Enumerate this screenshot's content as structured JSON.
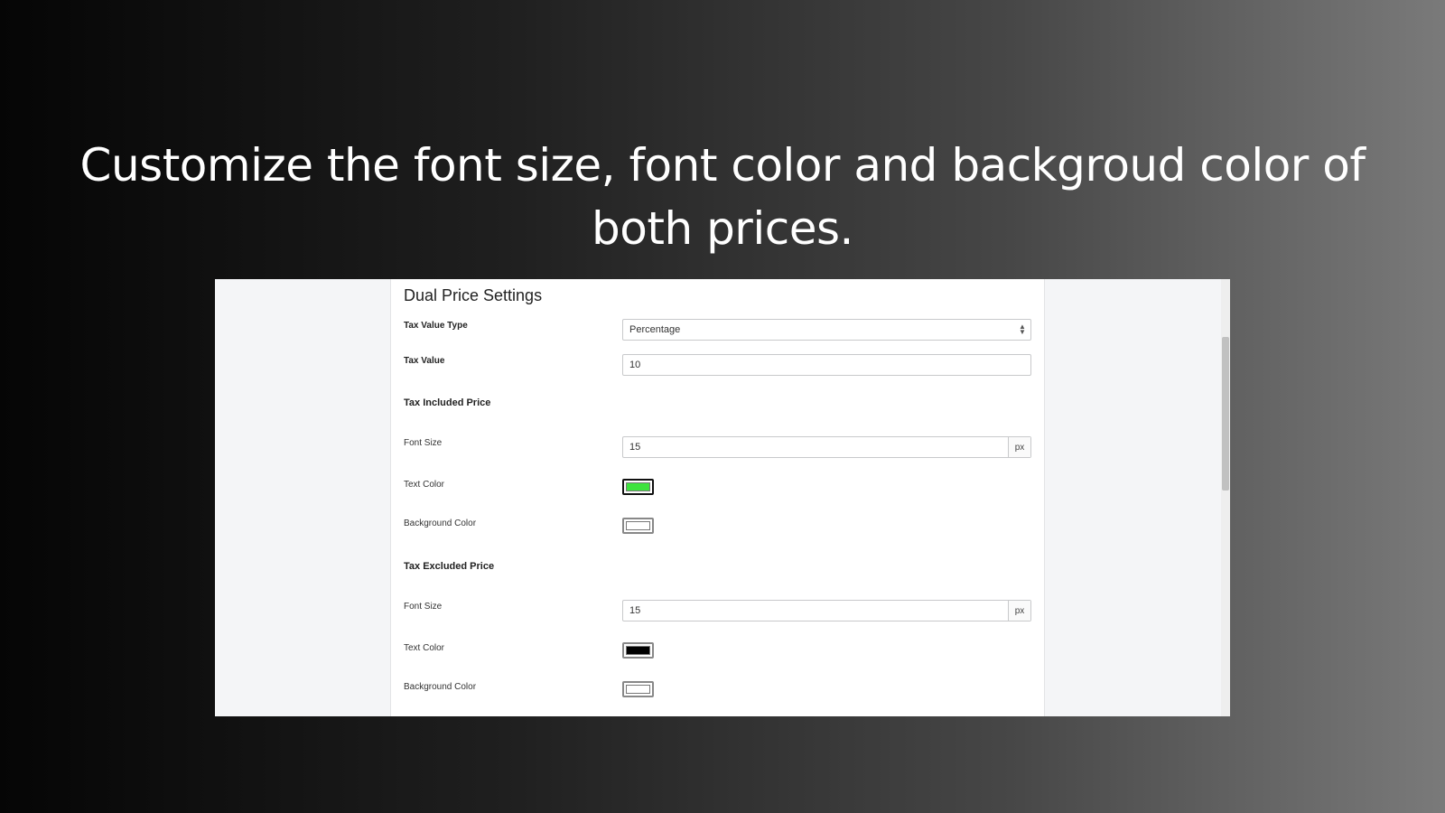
{
  "headline": "Customize the font size, font color and backgroud color of both prices.",
  "settings": {
    "title": "Dual Price Settings",
    "tax_value_type": {
      "label": "Tax Value Type",
      "value": "Percentage"
    },
    "tax_value": {
      "label": "Tax Value",
      "value": "10"
    },
    "included": {
      "title": "Tax Included Price",
      "font_size_label": "Font Size",
      "font_size": "15",
      "unit": "px",
      "text_color_label": "Text Color",
      "text_color": "#3ee33e",
      "bg_color_label": "Background Color",
      "bg_color": "#ffffff"
    },
    "excluded": {
      "title": "Tax Excluded Price",
      "font_size_label": "Font Size",
      "font_size": "15",
      "unit": "px",
      "text_color_label": "Text Color",
      "text_color": "#000000",
      "bg_color_label": "Background Color",
      "bg_color": "#ffffff"
    }
  }
}
